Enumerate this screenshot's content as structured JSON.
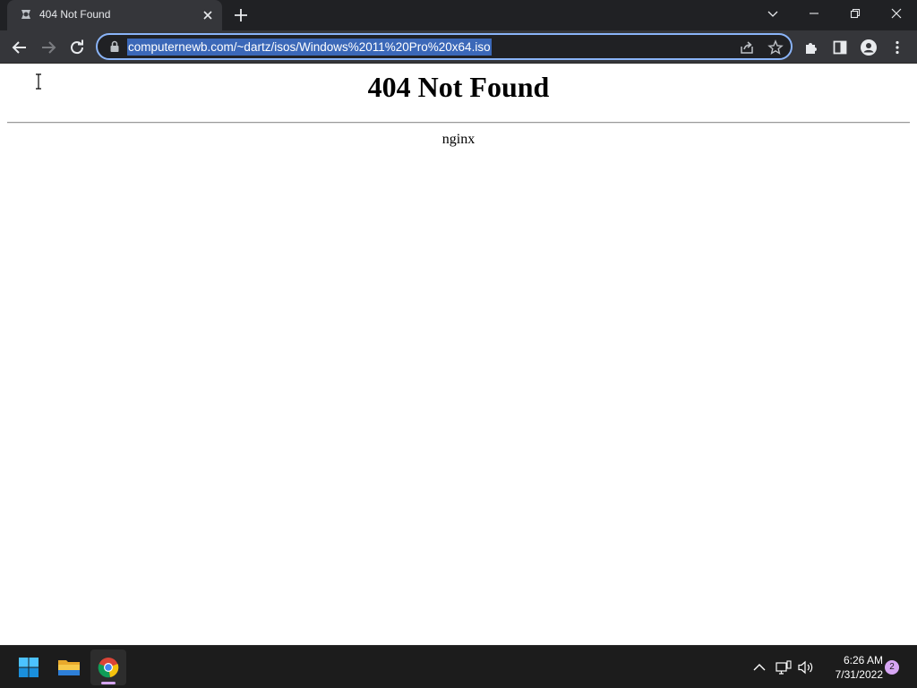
{
  "browser": {
    "tab_title": "404 Not Found",
    "url": "computernewb.com/~dartz/isos/Windows%2011%20Pro%20x64.iso",
    "favicon": "computernewb-logo-icon"
  },
  "page": {
    "heading": "404 Not Found",
    "server": "nginx"
  },
  "taskbar": {
    "apps": [
      "start-icon",
      "file-explorer-icon",
      "chrome-icon"
    ],
    "time": "6:26 AM",
    "date": "7/31/2022",
    "notification_count": "2"
  },
  "colors": {
    "accent": "#8ab4f8",
    "selection": "#3b68b8",
    "titlebar": "#202124",
    "toolbar": "#35363a",
    "taskbar": "#1c1c1c"
  }
}
